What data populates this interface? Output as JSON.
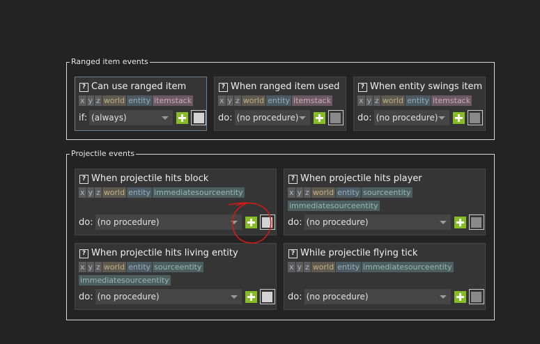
{
  "groups": {
    "ranged": {
      "title": "Ranged item events"
    },
    "projectile": {
      "title": "Projectile events"
    }
  },
  "panels": [
    {
      "title": "Can use ranged item",
      "tags": [
        "x",
        "y",
        "z",
        "world",
        "entity",
        "itemstack"
      ],
      "label": "if:",
      "value": "(always)"
    },
    {
      "title": "When ranged item used",
      "tags": [
        "x",
        "y",
        "z",
        "world",
        "entity",
        "itemstack"
      ],
      "label": "do:",
      "value": "(no procedure)"
    },
    {
      "title": "When entity swings item",
      "tags": [
        "x",
        "y",
        "z",
        "world",
        "entity",
        "itemstack"
      ],
      "label": "do:",
      "value": "(no procedure)"
    },
    {
      "title": "When projectile hits block",
      "tags": [
        "x",
        "y",
        "z",
        "world",
        "entity",
        "immediatesourceentity"
      ],
      "label": "do:",
      "value": "(no procedure)"
    },
    {
      "title": "When projectile hits player",
      "tags": [
        "x",
        "y",
        "z",
        "world",
        "entity",
        "sourceentity",
        "immediatesourceentity"
      ],
      "label": "do:",
      "value": "(no procedure)"
    },
    {
      "title": "When projectile hits living entity",
      "tags": [
        "x",
        "y",
        "z",
        "world",
        "entity",
        "sourceentity",
        "immediatesourceentity"
      ],
      "label": "do:",
      "value": "(no procedure)"
    },
    {
      "title": "While projectile flying tick",
      "tags": [
        "x",
        "y",
        "z",
        "world",
        "entity",
        "immediatesourceentity"
      ],
      "label": "do:",
      "value": "(no procedure)"
    }
  ],
  "colors": {
    "background": "#232323",
    "panel": "#353535",
    "add_button": "#86bd24",
    "annotation": "#d01a1a"
  },
  "icons": {
    "help": "question-box-icon",
    "add": "plus-icon",
    "edit": "square-icon"
  }
}
